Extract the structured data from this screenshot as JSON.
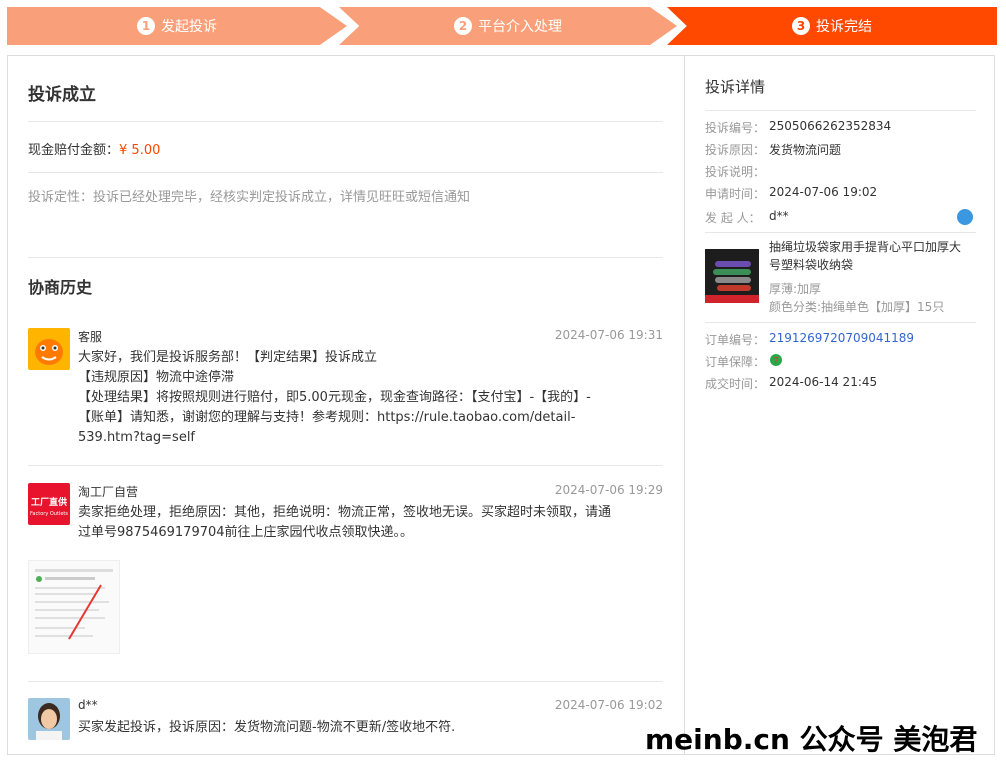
{
  "steps": [
    {
      "num": "1",
      "label": "发起投诉"
    },
    {
      "num": "2",
      "label": "平台介入处理"
    },
    {
      "num": "3",
      "label": "投诉完结"
    }
  ],
  "main": {
    "title": "投诉成立",
    "comp_label": "现金赔付金额：",
    "comp_amount": "¥ 5.00",
    "nature": "投诉定性：投诉已经处理完毕，经核实判定投诉成立，详情见旺旺或短信通知",
    "history_title": "协商历史"
  },
  "history": [
    {
      "name": "客服",
      "time": "2024-07-06 19:31",
      "lines": [
        "大家好，我们是投诉服务部！【判定结果】投诉成立",
        "【违规原因】物流中途停滞",
        "【处理结果】将按照规则进行赔付，即5.00元现金，现金查询路径：【支付宝】-【我的】-",
        "【账单】请知悉，谢谢您的理解与支持！参考规则：https://rule.taobao.com/detail-",
        "539.htm?tag=self"
      ]
    },
    {
      "name": "淘工厂自营",
      "time": "2024-07-06 19:29",
      "logo_text": "工厂直供",
      "logo_sub": "Factory Outlets",
      "lines": [
        "卖家拒绝处理，拒绝原因：其他，拒绝说明：物流正常，签收地无误。买家超时未领取，请通",
        "过单号9875469179704前往上庄家园代收点领取快递。。"
      ]
    },
    {
      "name": "d**",
      "time": "2024-07-06 19:02",
      "lines": [
        "买家发起投诉，投诉原因：发货物流问题-物流不更新/签收地不符."
      ]
    }
  ],
  "detail": {
    "title": "投诉详情",
    "rows": [
      {
        "k": "投诉编号：",
        "v": "2505066262352834"
      },
      {
        "k": "投诉原因：",
        "v": "发货物流问题"
      },
      {
        "k": "投诉说明：",
        "v": ""
      },
      {
        "k": "申请时间：",
        "v": "2024-07-06 19:02"
      },
      {
        "k": "发 起 人：",
        "v": "d**"
      }
    ],
    "product": {
      "title": "抽绳垃圾袋家用手提背心平口加厚大号塑料袋收纳袋",
      "spec1": "厚薄:加厚",
      "spec2": "颜色分类:抽绳单色【加厚】15只"
    },
    "order_rows": [
      {
        "k": "订单编号：",
        "v": "2191269720709041189"
      },
      {
        "k": "订单保障：",
        "v": ""
      },
      {
        "k": "成交时间：",
        "v": "2024-06-14 21:45"
      }
    ]
  },
  "watermark": "meinb.cn  公众号 美泡君",
  "colors": {
    "accent": "#ff4800",
    "step_light": "#f9a07a",
    "link": "#3366cc"
  }
}
